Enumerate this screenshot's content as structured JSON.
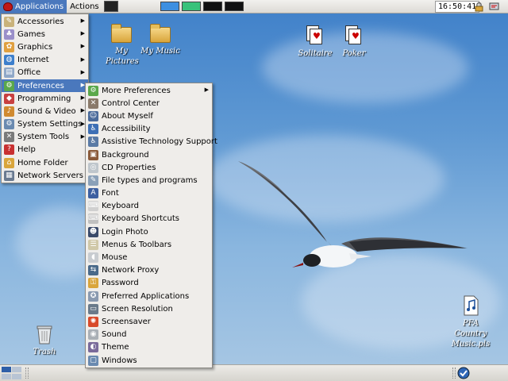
{
  "top_panel": {
    "applications_label": "Applications",
    "actions_label": "Actions",
    "clock": "16:50:41"
  },
  "desktop_icons": {
    "my_pictures": "My Pictures",
    "my_music": "My Music",
    "solitaire": "Solitaire",
    "poker": "Poker",
    "trash": "Trash",
    "playlist": "PFA Country Music.pls"
  },
  "applications_menu": [
    {
      "label": "Accessories",
      "icon": "accessories-icon",
      "submenu": true
    },
    {
      "label": "Games",
      "icon": "games-icon",
      "submenu": true
    },
    {
      "label": "Graphics",
      "icon": "graphics-icon",
      "submenu": true
    },
    {
      "label": "Internet",
      "icon": "internet-icon",
      "submenu": true
    },
    {
      "label": "Office",
      "icon": "office-icon",
      "submenu": true
    },
    {
      "label": "Preferences",
      "icon": "preferences-icon",
      "submenu": true,
      "highlighted": true
    },
    {
      "label": "Programming",
      "icon": "programming-icon",
      "submenu": true
    },
    {
      "label": "Sound & Video",
      "icon": "sound-video-icon",
      "submenu": true
    },
    {
      "label": "System Settings",
      "icon": "system-settings-icon",
      "submenu": true
    },
    {
      "label": "System Tools",
      "icon": "system-tools-icon",
      "submenu": true
    },
    {
      "label": "Help",
      "icon": "help-icon",
      "submenu": false
    },
    {
      "label": "Home Folder",
      "icon": "home-folder-icon",
      "submenu": false
    },
    {
      "label": "Network Servers",
      "icon": "network-servers-icon",
      "submenu": false
    }
  ],
  "preferences_menu": [
    {
      "label": "More Preferences",
      "icon": "more-preferences-icon",
      "submenu": true
    },
    {
      "label": "Control Center",
      "icon": "control-center-icon"
    },
    {
      "label": "About Myself",
      "icon": "about-myself-icon"
    },
    {
      "label": "Accessibility",
      "icon": "accessibility-icon"
    },
    {
      "label": "Assistive Technology Support",
      "icon": "assistive-technology-icon"
    },
    {
      "label": "Background",
      "icon": "background-icon"
    },
    {
      "label": "CD Properties",
      "icon": "cd-icon"
    },
    {
      "label": "File types and programs",
      "icon": "file-types-icon"
    },
    {
      "label": "Font",
      "icon": "font-icon"
    },
    {
      "label": "Keyboard",
      "icon": "keyboard-icon"
    },
    {
      "label": "Keyboard Shortcuts",
      "icon": "keyboard-shortcuts-icon"
    },
    {
      "label": "Login Photo",
      "icon": "login-photo-icon"
    },
    {
      "label": "Menus & Toolbars",
      "icon": "menus-toolbars-icon"
    },
    {
      "label": "Mouse",
      "icon": "mouse-icon"
    },
    {
      "label": "Network Proxy",
      "icon": "network-proxy-icon"
    },
    {
      "label": "Password",
      "icon": "password-icon"
    },
    {
      "label": "Preferred Applications",
      "icon": "preferred-applications-icon"
    },
    {
      "label": "Screen Resolution",
      "icon": "screen-resolution-icon"
    },
    {
      "label": "Screensaver",
      "icon": "screensaver-icon"
    },
    {
      "label": "Sound",
      "icon": "sound-icon"
    },
    {
      "label": "Theme",
      "icon": "theme-icon"
    },
    {
      "label": "Windows",
      "icon": "windows-icon"
    }
  ],
  "colors": {
    "highlight": "#4a78bd",
    "menu_bg": "#efedea",
    "panel_bg": "#dcdad5"
  }
}
